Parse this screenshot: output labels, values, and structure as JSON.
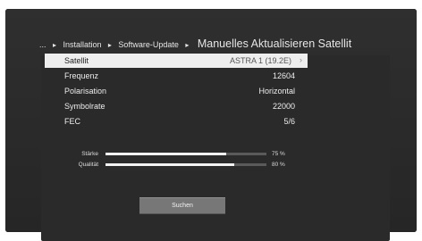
{
  "breadcrumb": {
    "ellipsis": "...",
    "sep": "▸",
    "items": [
      "Installation",
      "Software-Update"
    ],
    "title": "Manuelles Aktualisieren Satellit"
  },
  "settings": [
    {
      "label": "Satellit",
      "value": "ASTRA 1 (19.2E)",
      "selected": true
    },
    {
      "label": "Frequenz",
      "value": "12604"
    },
    {
      "label": "Polarisation",
      "value": "Horizontal"
    },
    {
      "label": "Symbolrate",
      "value": "22000"
    },
    {
      "label": "FEC",
      "value": "5/6"
    }
  ],
  "meters": {
    "staerke": {
      "label": "Stärke",
      "percent_text": "75 %",
      "percent": 75
    },
    "qualitaet": {
      "label": "Qualität",
      "percent_text": "80 %",
      "percent": 80
    }
  },
  "search_button": {
    "label": "Suchen"
  }
}
